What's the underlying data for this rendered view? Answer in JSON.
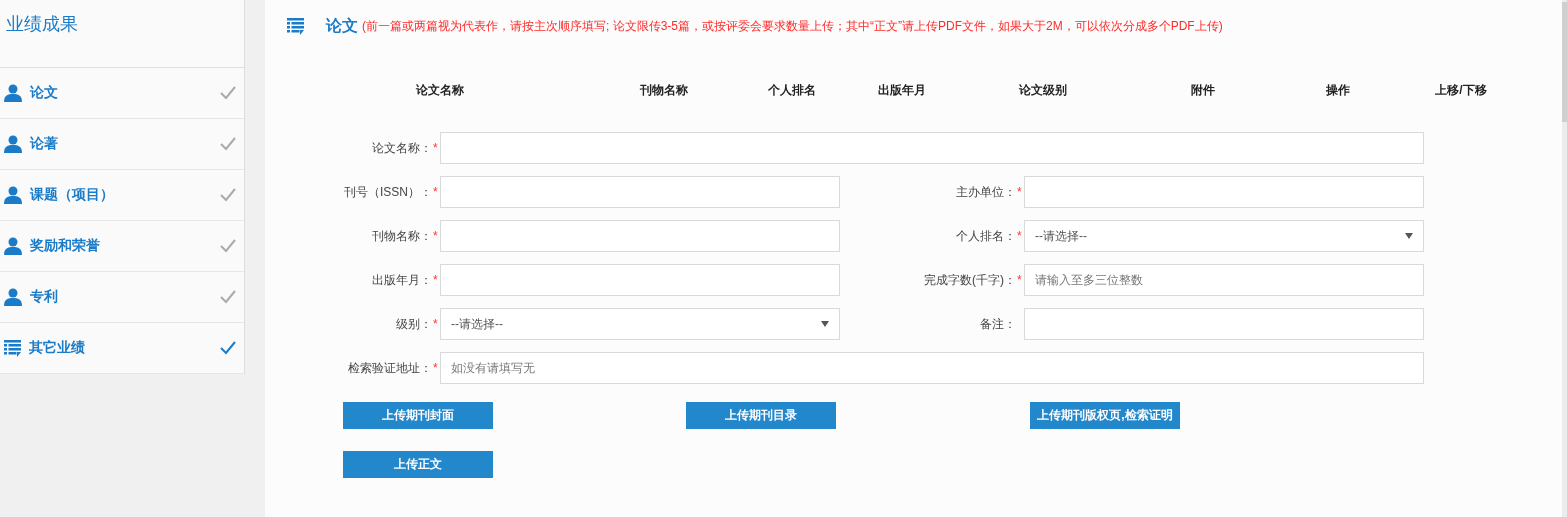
{
  "sidebar": {
    "title": "业绩成果",
    "items": [
      {
        "label": "论文",
        "selected": false
      },
      {
        "label": "论著",
        "selected": false
      },
      {
        "label": "课题（项目）",
        "selected": false
      },
      {
        "label": "奖励和荣誉",
        "selected": false
      },
      {
        "label": "专利",
        "selected": false
      },
      {
        "label": "其它业绩",
        "selected": true
      }
    ]
  },
  "section": {
    "title": "论文",
    "note": "(前一篇或两篇视为代表作，请按主次顺序填写; 论文限传3-5篇，或按评委会要求数量上传；其中“正文”请上传PDF文件，如果大于2M，可以依次分成多个PDF上传)"
  },
  "table": {
    "columns": [
      "论文名称",
      "刊物名称",
      "个人排名",
      "出版年月",
      "论文级别",
      "附件",
      "操作",
      "上移/下移"
    ]
  },
  "form": {
    "rows": [
      [
        {
          "label": "论文名称：",
          "required": true,
          "kind": "text",
          "wide": true
        }
      ],
      [
        {
          "label": "刊号（ISSN）：",
          "required": true,
          "kind": "text"
        },
        {
          "label": "主办单位：",
          "required": true,
          "kind": "text"
        }
      ],
      [
        {
          "label": "刊物名称：",
          "required": true,
          "kind": "text"
        },
        {
          "label": "个人排名：",
          "required": true,
          "kind": "select",
          "value": "--请选择--"
        }
      ],
      [
        {
          "label": "出版年月：",
          "required": true,
          "kind": "text"
        },
        {
          "label": "完成字数(千字)：",
          "required": true,
          "kind": "text",
          "placeholder": "请输入至多三位整数"
        }
      ],
      [
        {
          "label": "级别：",
          "required": true,
          "kind": "select",
          "value": "--请选择--"
        },
        {
          "label": "备注：",
          "required": false,
          "kind": "text"
        }
      ],
      [
        {
          "label": "检索验证地址：",
          "required": true,
          "kind": "text",
          "wide": true,
          "placeholder": "如没有请填写无"
        }
      ]
    ],
    "required_mark": "*"
  },
  "buttons": [
    [
      "上传期刊封面",
      "上传期刊目录",
      "上传期刊版权页,检索证明"
    ],
    [
      "上传正文"
    ]
  ]
}
